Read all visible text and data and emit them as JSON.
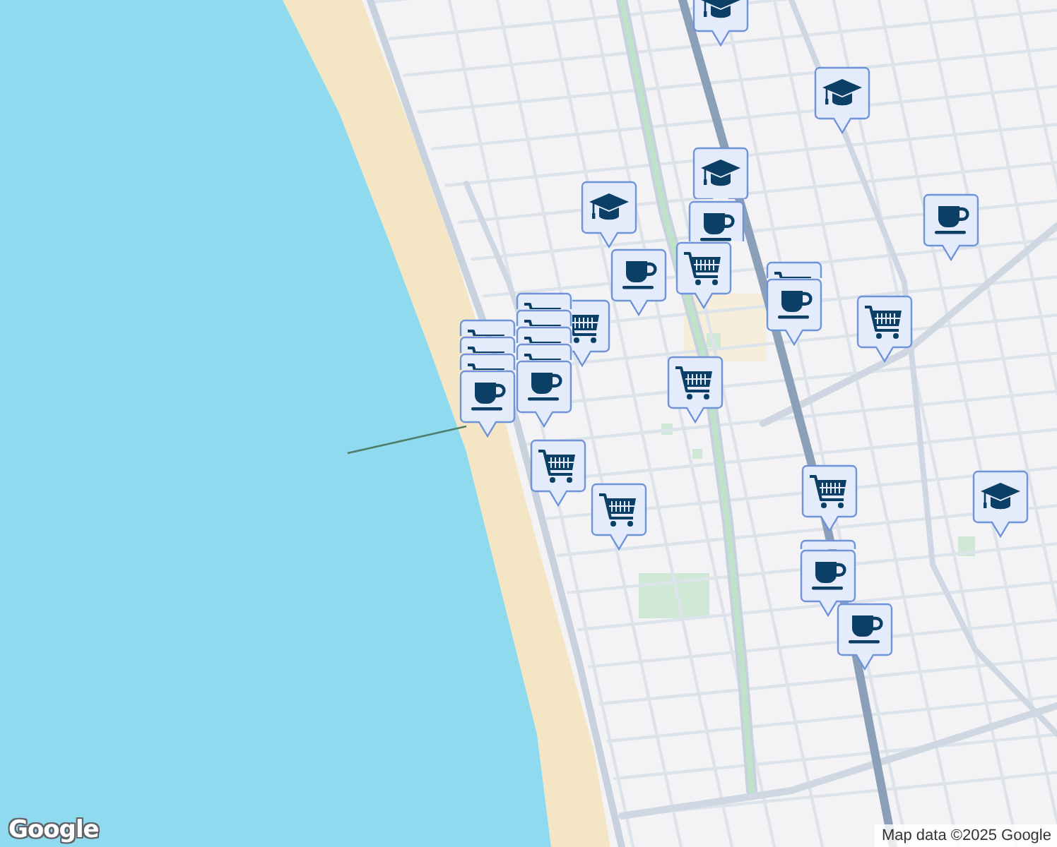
{
  "map": {
    "markers": [
      {
        "kind": "school"
      },
      {
        "kind": "school"
      },
      {
        "kind": "school"
      },
      {
        "kind": "school"
      },
      {
        "kind": "cafe"
      },
      {
        "kind": "cafe"
      },
      {
        "kind": "shop"
      },
      {
        "kind": "cafe"
      },
      {
        "kind": "shop"
      },
      {
        "kind": "shop"
      },
      {
        "kind": "shop"
      },
      {
        "kind": "shop"
      },
      {
        "kind": "shop"
      },
      {
        "kind": "cafe"
      },
      {
        "kind": "shop"
      },
      {
        "kind": "shop"
      },
      {
        "kind": "shop"
      },
      {
        "kind": "cafe"
      },
      {
        "kind": "shop"
      },
      {
        "kind": "cafe"
      },
      {
        "kind": "shop"
      },
      {
        "kind": "shop"
      },
      {
        "kind": "shop"
      },
      {
        "kind": "shop"
      },
      {
        "kind": "school"
      },
      {
        "kind": "shop"
      },
      {
        "kind": "cafe"
      },
      {
        "kind": "cafe"
      },
      {
        "kind": "cafe"
      }
    ]
  },
  "logo": {
    "text": "Google"
  },
  "attribution": "Map data ©2025 Google"
}
